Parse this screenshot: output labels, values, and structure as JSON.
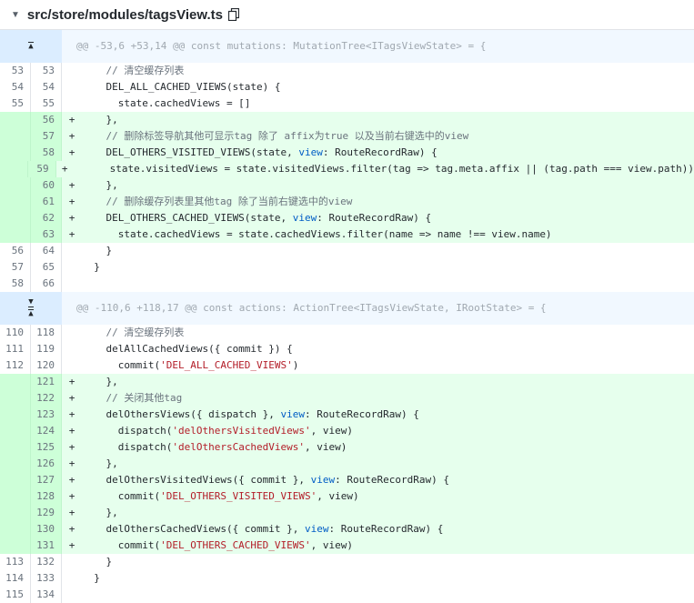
{
  "file": {
    "path": "src/store/modules/tagsView.ts",
    "caret_icon": "caret-down-icon",
    "copy_icon": "copy-icon"
  },
  "hunks": [
    {
      "header": "@@ -53,6 +53,14 @@ const mutations: MutationTree<ITagsViewState> = {",
      "expander": [
        "expand-up"
      ],
      "lines": [
        {
          "old": "53",
          "new": "53",
          "type": "ctx",
          "tokens": [
            [
              "    ",
              ""
            ],
            [
              "// 清空缓存列表",
              "cm"
            ]
          ]
        },
        {
          "old": "54",
          "new": "54",
          "type": "ctx",
          "tokens": [
            [
              "    DEL_ALL_CACHED_VIEWS(state) {",
              ""
            ]
          ]
        },
        {
          "old": "55",
          "new": "55",
          "type": "ctx",
          "tokens": [
            [
              "      state.cachedViews = []",
              ""
            ]
          ]
        },
        {
          "old": "",
          "new": "56",
          "type": "add",
          "tokens": [
            [
              "    },",
              ""
            ]
          ]
        },
        {
          "old": "",
          "new": "57",
          "type": "add",
          "tokens": [
            [
              "    ",
              ""
            ],
            [
              "// 删除标签导航其他可显示tag 除了 affix为true 以及当前右键选中的view",
              "cm"
            ]
          ]
        },
        {
          "old": "",
          "new": "58",
          "type": "add",
          "tokens": [
            [
              "    DEL_OTHERS_VISITED_VIEWS(state, ",
              ""
            ],
            [
              "view",
              "ty"
            ],
            [
              ": RouteRecordRaw) {",
              ""
            ]
          ]
        },
        {
          "old": "",
          "new": "59",
          "type": "add",
          "tokens": [
            [
              "      state.visitedViews = state.visitedViews.filter(tag => tag.meta.affix || (tag.path === view.path))",
              ""
            ]
          ]
        },
        {
          "old": "",
          "new": "60",
          "type": "add",
          "tokens": [
            [
              "    },",
              ""
            ]
          ]
        },
        {
          "old": "",
          "new": "61",
          "type": "add",
          "tokens": [
            [
              "    ",
              ""
            ],
            [
              "// 删除缓存列表里其他tag 除了当前右键选中的view",
              "cm"
            ]
          ]
        },
        {
          "old": "",
          "new": "62",
          "type": "add",
          "tokens": [
            [
              "    DEL_OTHERS_CACHED_VIEWS(state, ",
              ""
            ],
            [
              "view",
              "ty"
            ],
            [
              ": RouteRecordRaw) {",
              ""
            ]
          ]
        },
        {
          "old": "",
          "new": "63",
          "type": "add",
          "tokens": [
            [
              "      state.cachedViews = state.cachedViews.filter(name => name !== view.name)",
              ""
            ]
          ]
        },
        {
          "old": "56",
          "new": "64",
          "type": "ctx",
          "tokens": [
            [
              "    }",
              ""
            ]
          ]
        },
        {
          "old": "57",
          "new": "65",
          "type": "ctx",
          "tokens": [
            [
              "  }",
              ""
            ]
          ]
        },
        {
          "old": "58",
          "new": "66",
          "type": "ctx",
          "tokens": [
            [
              "",
              ""
            ]
          ]
        }
      ]
    },
    {
      "header": "@@ -110,6 +118,17 @@ const actions: ActionTree<ITagsViewState, IRootState> = {",
      "expander": [
        "expand-down",
        "expand-up"
      ],
      "lines": [
        {
          "old": "110",
          "new": "118",
          "type": "ctx",
          "tokens": [
            [
              "    ",
              ""
            ],
            [
              "// 清空缓存列表",
              "cm"
            ]
          ]
        },
        {
          "old": "111",
          "new": "119",
          "type": "ctx",
          "tokens": [
            [
              "    delAllCachedViews({ commit }) {",
              ""
            ]
          ]
        },
        {
          "old": "112",
          "new": "120",
          "type": "ctx",
          "tokens": [
            [
              "      commit(",
              ""
            ],
            [
              "'DEL_ALL_CACHED_VIEWS'",
              "str"
            ],
            [
              ")",
              ""
            ]
          ]
        },
        {
          "old": "",
          "new": "121",
          "type": "add",
          "tokens": [
            [
              "    },",
              ""
            ]
          ]
        },
        {
          "old": "",
          "new": "122",
          "type": "add",
          "tokens": [
            [
              "    ",
              ""
            ],
            [
              "// 关闭其他tag",
              "cm"
            ]
          ]
        },
        {
          "old": "",
          "new": "123",
          "type": "add",
          "tokens": [
            [
              "    delOthersViews({ dispatch }, ",
              ""
            ],
            [
              "view",
              "ty"
            ],
            [
              ": RouteRecordRaw) {",
              ""
            ]
          ]
        },
        {
          "old": "",
          "new": "124",
          "type": "add",
          "tokens": [
            [
              "      dispatch(",
              ""
            ],
            [
              "'delOthersVisitedViews'",
              "str"
            ],
            [
              ", view)",
              ""
            ]
          ]
        },
        {
          "old": "",
          "new": "125",
          "type": "add",
          "tokens": [
            [
              "      dispatch(",
              ""
            ],
            [
              "'delOthersCachedViews'",
              "str"
            ],
            [
              ", view)",
              ""
            ]
          ]
        },
        {
          "old": "",
          "new": "126",
          "type": "add",
          "tokens": [
            [
              "    },",
              ""
            ]
          ]
        },
        {
          "old": "",
          "new": "127",
          "type": "add",
          "tokens": [
            [
              "    delOthersVisitedViews({ commit }, ",
              ""
            ],
            [
              "view",
              "ty"
            ],
            [
              ": RouteRecordRaw) {",
              ""
            ]
          ]
        },
        {
          "old": "",
          "new": "128",
          "type": "add",
          "tokens": [
            [
              "      commit(",
              ""
            ],
            [
              "'DEL_OTHERS_VISITED_VIEWS'",
              "str"
            ],
            [
              ", view)",
              ""
            ]
          ]
        },
        {
          "old": "",
          "new": "129",
          "type": "add",
          "tokens": [
            [
              "    },",
              ""
            ]
          ]
        },
        {
          "old": "",
          "new": "130",
          "type": "add",
          "tokens": [
            [
              "    delOthersCachedViews({ commit }, ",
              ""
            ],
            [
              "view",
              "ty"
            ],
            [
              ": RouteRecordRaw) {",
              ""
            ]
          ]
        },
        {
          "old": "",
          "new": "131",
          "type": "add",
          "tokens": [
            [
              "      commit(",
              ""
            ],
            [
              "'DEL_OTHERS_CACHED_VIEWS'",
              "str"
            ],
            [
              ", view)",
              ""
            ]
          ]
        },
        {
          "old": "113",
          "new": "132",
          "type": "ctx",
          "tokens": [
            [
              "    }",
              ""
            ]
          ]
        },
        {
          "old": "114",
          "new": "133",
          "type": "ctx",
          "tokens": [
            [
              "  }",
              ""
            ]
          ]
        },
        {
          "old": "115",
          "new": "134",
          "type": "ctx",
          "tokens": [
            [
              "",
              ""
            ]
          ]
        }
      ]
    }
  ]
}
